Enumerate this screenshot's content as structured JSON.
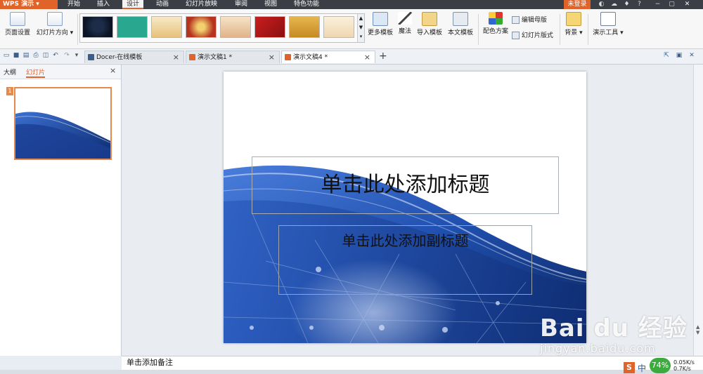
{
  "app": {
    "name": "WPS 演示",
    "login": "未登录"
  },
  "menu": [
    "开始",
    "插入",
    "设计",
    "动画",
    "幻灯片放映",
    "审阅",
    "视图",
    "特色功能"
  ],
  "menu_active": "设计",
  "ribbon": {
    "page_setup": "页面设置",
    "slide_direction": "幻灯片方向",
    "more_templates": "更多模板",
    "magic": "魔法",
    "import_template": "导入模板",
    "this_template": "本文模板",
    "color_scheme": "配色方案",
    "edit_master": "编辑母版",
    "slide_layout": "幻灯片版式",
    "background": "背景",
    "show_tools": "演示工具"
  },
  "tabs": [
    {
      "label": "Docer-在线模板",
      "active": false
    },
    {
      "label": "演示文稿1 *",
      "active": false
    },
    {
      "label": "演示文稿4 *",
      "active": true
    }
  ],
  "panel": {
    "tab_outline": "大纲",
    "tab_slides": "幻灯片",
    "slide_number": "1"
  },
  "slide": {
    "title_placeholder": "单击此处添加标题",
    "subtitle_placeholder": "单击此处添加副标题"
  },
  "notes": {
    "placeholder": "单击添加备注"
  },
  "overlay": {
    "watermark_brand": "Bai du 经验",
    "watermark_url": "jingyan.baidu.com",
    "cpu_percent": "74%",
    "net_up": "0.05K/s",
    "net_down": "0.7K/s",
    "ime_label": "中"
  },
  "colors": {
    "accent": "#e0632a",
    "titlebar": "#3b3f45",
    "slide_blue": "#1e4fa5"
  }
}
